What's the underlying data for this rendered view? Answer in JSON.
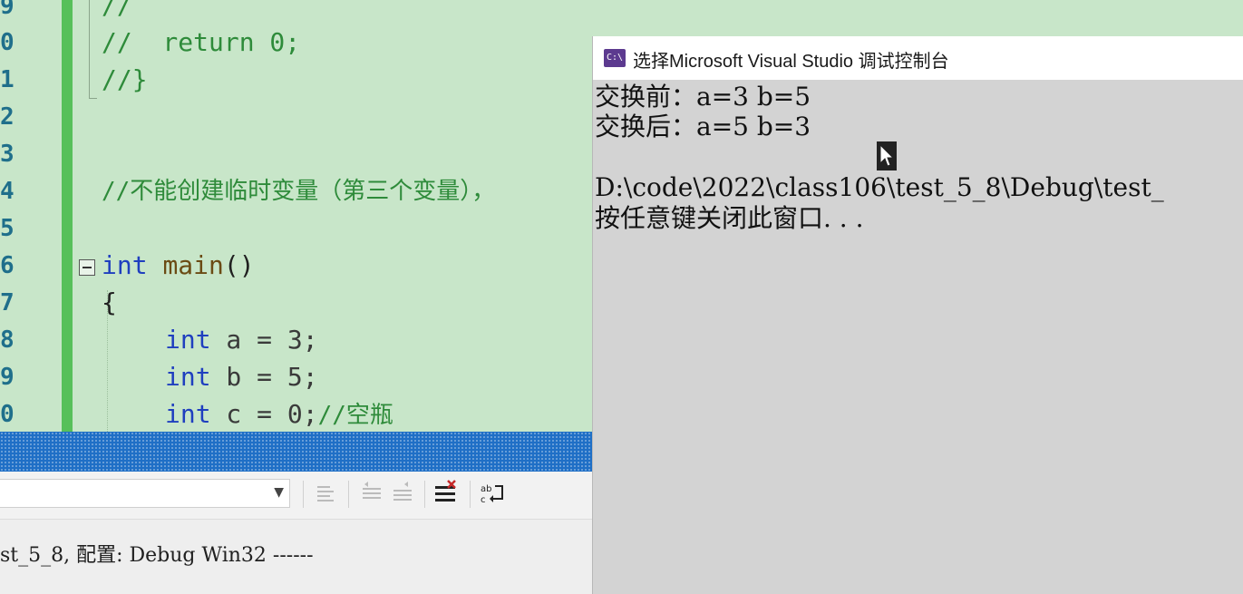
{
  "editor": {
    "line_numbers": [
      "9",
      "0",
      "1",
      "2",
      "3",
      "4",
      "5",
      "6",
      "7",
      "8",
      "9",
      "0"
    ],
    "lines": {
      "l0": "//",
      "l1": "//  return 0;",
      "l2": "//}",
      "l5_comment": "//不能创建临时变量（第三个变量），",
      "l7_kw": "int",
      "l7_fn": "main",
      "l7_rest": "()",
      "l8": "{",
      "l9_kw": "int",
      "l9_rest": " a = 3;",
      "l10_kw": "int",
      "l10_rest": " b = 5;",
      "l11_kw": "int",
      "l11_rest": " c = 0;",
      "l11_comment": "//空瓶"
    }
  },
  "output_panel": {
    "text": "st_5_8, 配置: Debug Win32 ------"
  },
  "console": {
    "title": "选择Microsoft Visual Studio 调试控制台",
    "icon_label": "C:\\",
    "lines": [
      "交换前：a=3 b=5",
      "交换后：a=5 b=3",
      "",
      "D:\\code\\2022\\class106\\test_5_8\\Debug\\test_",
      "按任意键关闭此窗口. . ."
    ]
  },
  "colors": {
    "editor_bg": "#c8e6c9",
    "change_bar": "#57c05a",
    "console_bg": "#d3d3d3",
    "panel_title_blue": "#1f6fc6"
  }
}
